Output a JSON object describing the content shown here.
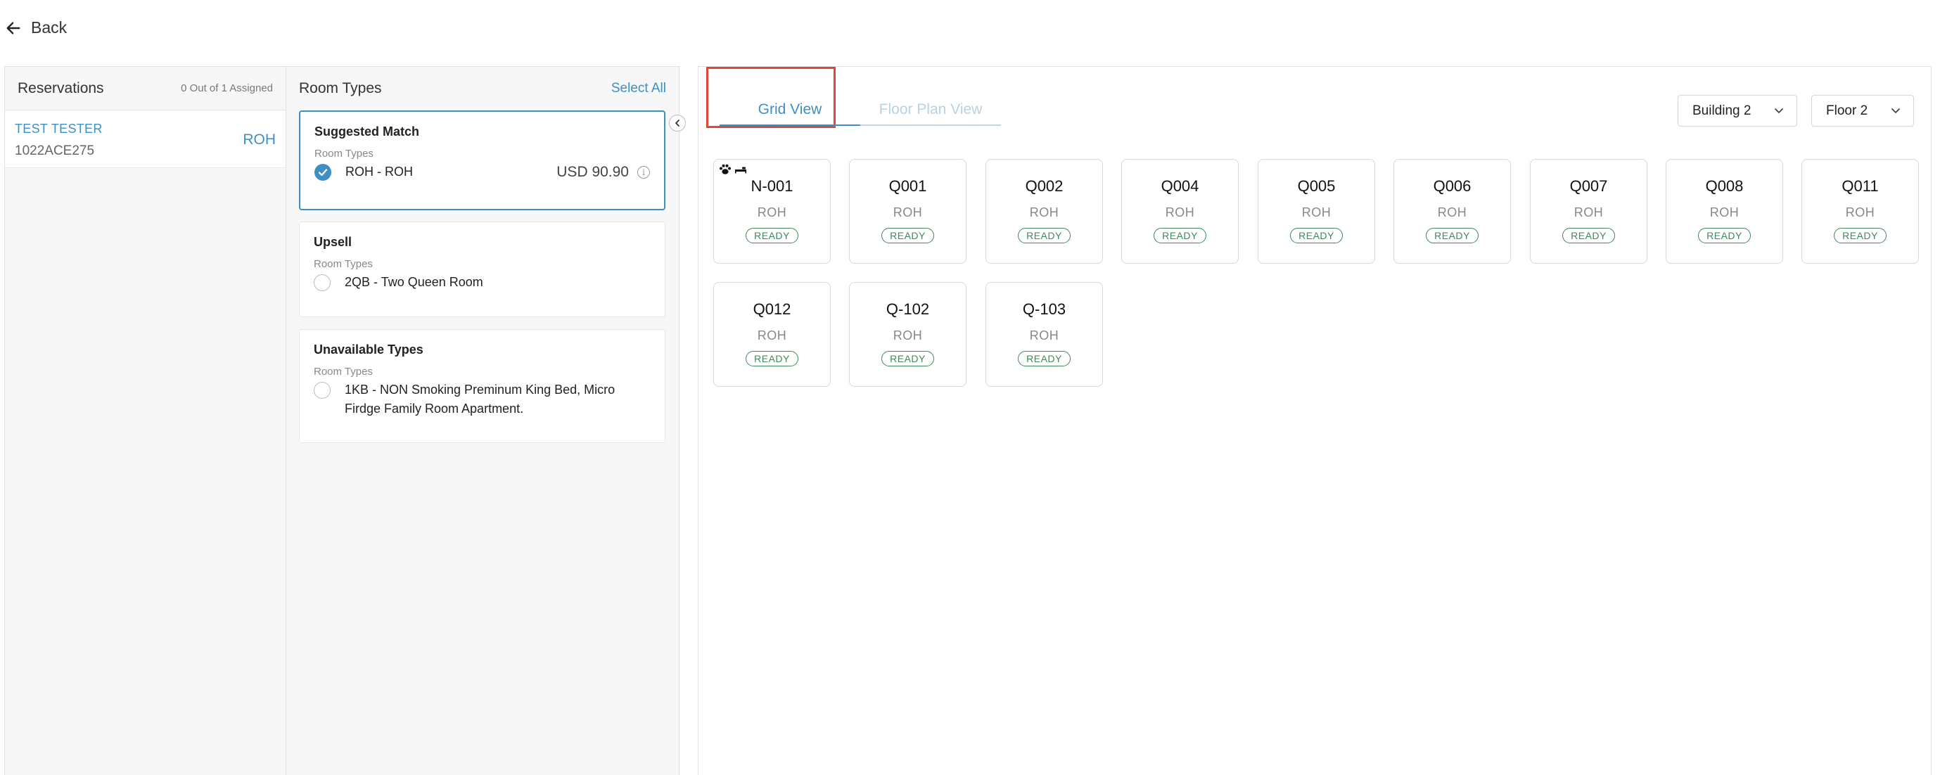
{
  "nav": {
    "back_label": "Back"
  },
  "reservations": {
    "title": "Reservations",
    "assigned_count": "0 Out of 1 Assigned",
    "items": [
      {
        "name": "TEST TESTER",
        "id": "1022ACE275",
        "room_type": "ROH"
      }
    ]
  },
  "room_types": {
    "title": "Room Types",
    "select_all": "Select All",
    "suggested": {
      "title": "Suggested Match",
      "subtitle": "Room Types",
      "option_label": "ROH - ROH",
      "price": "USD 90.90"
    },
    "upsell": {
      "title": "Upsell",
      "subtitle": "Room Types",
      "option_label": "2QB - Two Queen Room"
    },
    "unavailable": {
      "title": "Unavailable Types",
      "subtitle": "Room Types",
      "option_label": "1KB - NON Smoking Preminum King Bed, Micro Firdge Family Room Apartment."
    }
  },
  "grid": {
    "tabs": [
      {
        "label": "Grid View",
        "active": true
      },
      {
        "label": "Floor Plan View",
        "active": false
      }
    ],
    "building_select": "Building 2",
    "floor_select": "Floor 2",
    "rooms": [
      {
        "number": "N-001",
        "type": "ROH",
        "status": "READY",
        "icons": [
          "paw-icon",
          "bed-icon"
        ]
      },
      {
        "number": "Q001",
        "type": "ROH",
        "status": "READY"
      },
      {
        "number": "Q002",
        "type": "ROH",
        "status": "READY"
      },
      {
        "number": "Q004",
        "type": "ROH",
        "status": "READY"
      },
      {
        "number": "Q005",
        "type": "ROH",
        "status": "READY"
      },
      {
        "number": "Q006",
        "type": "ROH",
        "status": "READY"
      },
      {
        "number": "Q007",
        "type": "ROH",
        "status": "READY"
      },
      {
        "number": "Q008",
        "type": "ROH",
        "status": "READY"
      },
      {
        "number": "Q011",
        "type": "ROH",
        "status": "READY"
      },
      {
        "number": "Q012",
        "type": "ROH",
        "status": "READY"
      },
      {
        "number": "Q-102",
        "type": "ROH",
        "status": "READY"
      },
      {
        "number": "Q-103",
        "type": "ROH",
        "status": "READY"
      }
    ]
  },
  "colors": {
    "accent": "#3d8fc4",
    "ready": "#3f8a58",
    "highlight": "#e0453a"
  }
}
